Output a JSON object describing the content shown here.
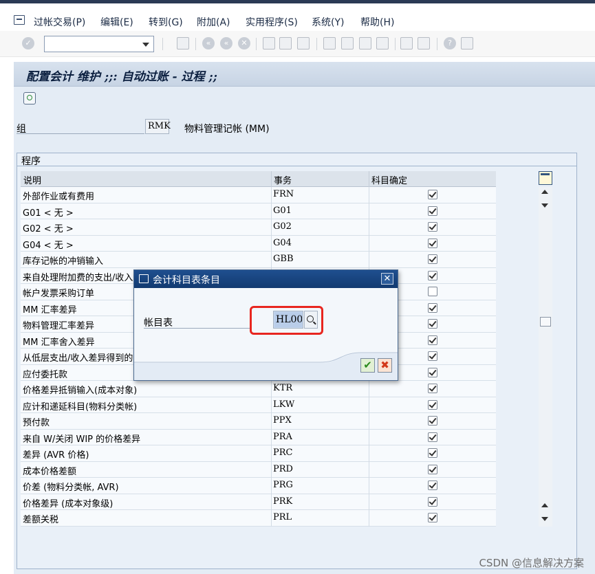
{
  "menubar": {
    "items": [
      "过帐交易(P)",
      "编辑(E)",
      "转到(G)",
      "附加(A)",
      "实用程序(S)",
      "系统(Y)",
      "帮助(H)"
    ]
  },
  "toolbar": {
    "command_field_value": "",
    "icons": [
      "enter-icon",
      "save-icon",
      "back-icon",
      "exit-icon",
      "cancel-icon",
      "print-icon",
      "find-icon",
      "find-next-icon",
      "first-page-icon",
      "prev-page-icon",
      "next-page-icon",
      "last-page-icon",
      "create-session-icon",
      "shortcut-icon",
      "help-icon",
      "customize-layout-icon"
    ]
  },
  "page": {
    "title": "配置会计 维护 ;;: 自动过账 - 过程 ;;"
  },
  "group": {
    "label": "组",
    "value": "RMK",
    "description": "物料管理记帐 (MM)"
  },
  "procedures": {
    "section_title": "程序",
    "columns": [
      "说明",
      "事务",
      "科目确定"
    ],
    "rows": [
      {
        "desc": "外部作业或有费用",
        "code": "FRN",
        "checked": true
      },
      {
        "desc": "G01 < 无 >",
        "code": "G01",
        "checked": true
      },
      {
        "desc": "G02 < 无 >",
        "code": "G02",
        "checked": true
      },
      {
        "desc": "G04 < 无 >",
        "code": "G04",
        "checked": true
      },
      {
        "desc": "库存记帐的冲销输入",
        "code": "GBB",
        "checked": true
      },
      {
        "desc": "来自处理附加费的支出/收入",
        "code": "",
        "checked": true
      },
      {
        "desc": "帐户发票采购订单",
        "code": "",
        "checked": false
      },
      {
        "desc": "MM 汇率差异",
        "code": "",
        "checked": true
      },
      {
        "desc": "物料管理汇率差异",
        "code": "",
        "checked": true
      },
      {
        "desc": "MM 汇率舍入差异",
        "code": "",
        "checked": true
      },
      {
        "desc": "从低层支出/收入差异得到的",
        "code": "",
        "checked": true
      },
      {
        "desc": "应付委托款",
        "code": "",
        "checked": true
      },
      {
        "desc": "价格差异抵销输入(成本对象)",
        "code": "KTR",
        "checked": true
      },
      {
        "desc": "应计和递延科目(物料分类帐)",
        "code": "LKW",
        "checked": true
      },
      {
        "desc": "预付款",
        "code": "PPX",
        "checked": true
      },
      {
        "desc": "来自 W/关闭 WIP 的价格差异",
        "code": "PRA",
        "checked": true
      },
      {
        "desc": "差异 (AVR 价格)",
        "code": "PRC",
        "checked": true
      },
      {
        "desc": "成本价格差额",
        "code": "PRD",
        "checked": true
      },
      {
        "desc": "价差 (物料分类帐, AVR)",
        "code": "PRG",
        "checked": true
      },
      {
        "desc": "价格差异 (成本对象级)",
        "code": "PRK",
        "checked": true
      },
      {
        "desc": "差额关税",
        "code": "PRL",
        "checked": true
      }
    ]
  },
  "dialog": {
    "title": "会计科目表条目",
    "field_label": "帐目表",
    "field_value": "HL00",
    "highlight_color": "#e8261f"
  },
  "watermark": "CSDN @信息解决方案"
}
